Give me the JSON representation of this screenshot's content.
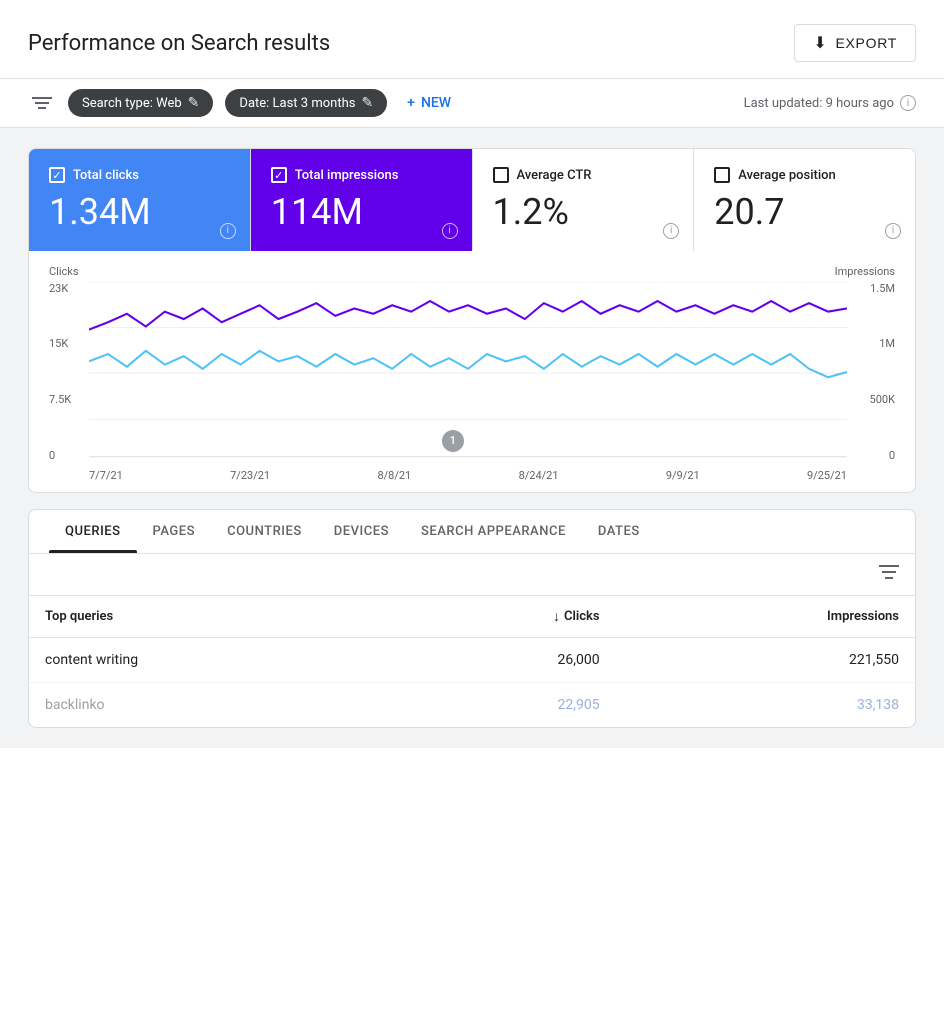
{
  "header": {
    "title": "Performance on Search results",
    "export_label": "EXPORT"
  },
  "toolbar": {
    "filter_icon": "≡",
    "chip1": {
      "label": "Search type: Web",
      "edit_icon": "✎"
    },
    "chip2": {
      "label": "Date: Last 3 months",
      "edit_icon": "✎"
    },
    "new_label": "NEW",
    "new_icon": "+",
    "last_updated": "Last updated: 9 hours ago"
  },
  "metrics": [
    {
      "id": "total-clicks",
      "label": "Total clicks",
      "value": "1.34M",
      "checked": true,
      "style": "active-blue"
    },
    {
      "id": "total-impressions",
      "label": "Total impressions",
      "value": "114M",
      "checked": true,
      "style": "active-purple"
    },
    {
      "id": "avg-ctr",
      "label": "Average CTR",
      "value": "1.2%",
      "checked": false,
      "style": "inactive"
    },
    {
      "id": "avg-position",
      "label": "Average position",
      "value": "20.7",
      "checked": false,
      "style": "inactive"
    }
  ],
  "chart": {
    "left_label": "Clicks",
    "right_label": "Impressions",
    "y_axis_left": [
      "23K",
      "15K",
      "7.5K",
      "0"
    ],
    "y_axis_right": [
      "1.5M",
      "1M",
      "500K",
      "0"
    ],
    "x_axis": [
      "7/7/21",
      "7/23/21",
      "8/8/21",
      "8/24/21",
      "9/9/21",
      "9/25/21"
    ],
    "marker_label": "1"
  },
  "table_section": {
    "tabs": [
      {
        "id": "queries",
        "label": "QUERIES",
        "active": true
      },
      {
        "id": "pages",
        "label": "PAGES",
        "active": false
      },
      {
        "id": "countries",
        "label": "COUNTRIES",
        "active": false
      },
      {
        "id": "devices",
        "label": "DEVICES",
        "active": false
      },
      {
        "id": "search-appearance",
        "label": "SEARCH APPEARANCE",
        "active": false
      },
      {
        "id": "dates",
        "label": "DATES",
        "active": false
      }
    ],
    "columns": [
      {
        "id": "query",
        "label": "Top queries",
        "sortable": false
      },
      {
        "id": "clicks",
        "label": "Clicks",
        "sortable": true,
        "sort_dir": "desc"
      },
      {
        "id": "impressions",
        "label": "Impressions",
        "sortable": false
      }
    ],
    "rows": [
      {
        "query": "content writing",
        "clicks": "26,000",
        "impressions": "221,550",
        "dimmed": false
      },
      {
        "query": "backlinko",
        "clicks": "22,905",
        "impressions": "33,138",
        "dimmed": true
      }
    ]
  }
}
